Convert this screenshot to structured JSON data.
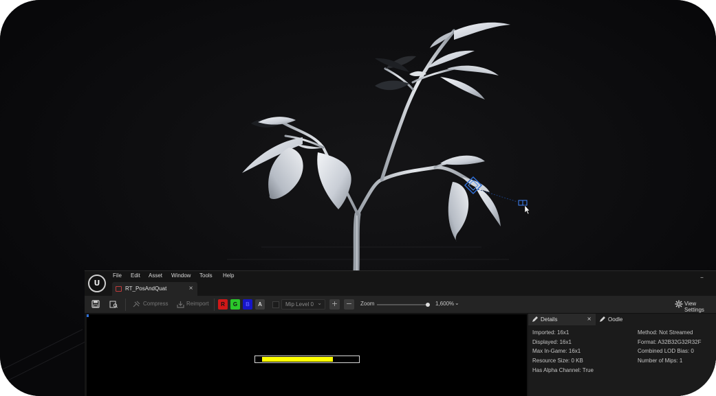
{
  "menubar": {
    "items": [
      "File",
      "Edit",
      "Asset",
      "Window",
      "Tools",
      "Help"
    ],
    "logo_text": "U",
    "minimize": "–"
  },
  "document_tab": {
    "label": "RT_PosAndQuat",
    "close": "×"
  },
  "toolbar": {
    "compress_label": "Compress",
    "reimport_label": "Reimport",
    "channels": [
      {
        "label": "R",
        "color": "#d01818"
      },
      {
        "label": "G",
        "color": "#2bc92b"
      },
      {
        "label": "B",
        "color": "#1616c8"
      },
      {
        "label": "A",
        "color": "#3c3c3c"
      }
    ],
    "mip_level": "Mip Level 0",
    "zoom_label": "Zoom",
    "zoom_value": "1,600%",
    "zoom_level": 0.95,
    "view_settings_label": "View Settings",
    "plus": "+",
    "minus": "−"
  },
  "texture_preview": {
    "filled_fraction": 0.75,
    "fill_color": "#ffff00"
  },
  "details": {
    "tabs": [
      {
        "label": "Details",
        "close": "×"
      },
      {
        "label": "Oodle"
      }
    ],
    "left_properties": [
      "Imported: 16x1",
      "Displayed: 16x1",
      "Max In-Game: 16x1",
      "Resource Size: 0 KB",
      "Has Alpha Channel: True"
    ],
    "right_properties": [
      "Method: Not Streamed",
      "Format: A32B32G32R32F",
      "Combined LOD Bias: 0",
      "Number of Mips: 1"
    ]
  },
  "colors": {
    "accent_blue": "#2f6fd6",
    "panel_bg": "#151515",
    "viewport_bg": "#0b0b0c"
  }
}
